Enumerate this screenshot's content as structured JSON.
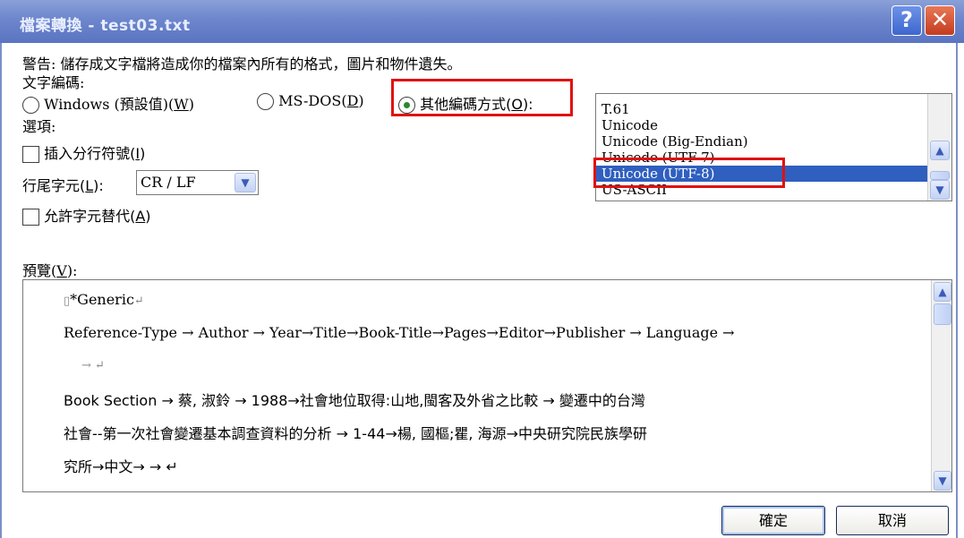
{
  "window": {
    "title": "檔案轉換 - test03.txt",
    "help_label": "?",
    "close_label": "✕"
  },
  "warning": "警告: 儲存成文字檔將造成你的檔案內所有的格式，圖片和物件遺失。",
  "encoding": {
    "label": "文字編碼:",
    "windows": {
      "text": "Windows (預設值)(",
      "key": "W",
      "end": ")"
    },
    "msdos": {
      "text": "MS-DOS(",
      "key": "D",
      "end": ")"
    },
    "other": {
      "text": "其他編碼方式(",
      "key": "O",
      "end": "):"
    },
    "selected": "other",
    "list": [
      "T.61",
      "Unicode",
      "Unicode (Big-Endian)",
      "Unicode (UTF-7)",
      "Unicode (UTF-8)",
      "US-ASCII"
    ],
    "list_selected": "Unicode (UTF-8)"
  },
  "options": {
    "label": "選項:",
    "insert_breaks": {
      "text": "插入分行符號(",
      "key": "I",
      "end": ")",
      "checked": false
    },
    "line_end": {
      "text": "行尾字元(",
      "key": "L",
      "end": "):",
      "value": "CR / LF"
    },
    "allow_sub": {
      "text": "允許字元替代(",
      "key": "A",
      "end": ")",
      "checked": false
    }
  },
  "preview": {
    "label": "預覽(",
    "key": "V",
    "end": "):",
    "lines": [
      "*Generic",
      "Reference-Type → Author → Year→Title→Book-Title→Pages→Editor→Publisher → Language →",
      "→ ↵",
      "Book Section → 蔡, 淑鈴 → 1988→社會地位取得:山地,閩客及外省之比較 → 變遷中的台灣",
      "社會--第一次社會變遷基本調查資料的分析 → 1-44→楊, 國樞;瞿, 海源→中央研究院民族學研",
      "究所→中文→ → ↵"
    ]
  },
  "buttons": {
    "ok": "確定",
    "cancel": "取消"
  },
  "colors": {
    "titlebar": "#6d86cc",
    "selection": "#2f5fbf",
    "highlight_box": "#e01010"
  }
}
